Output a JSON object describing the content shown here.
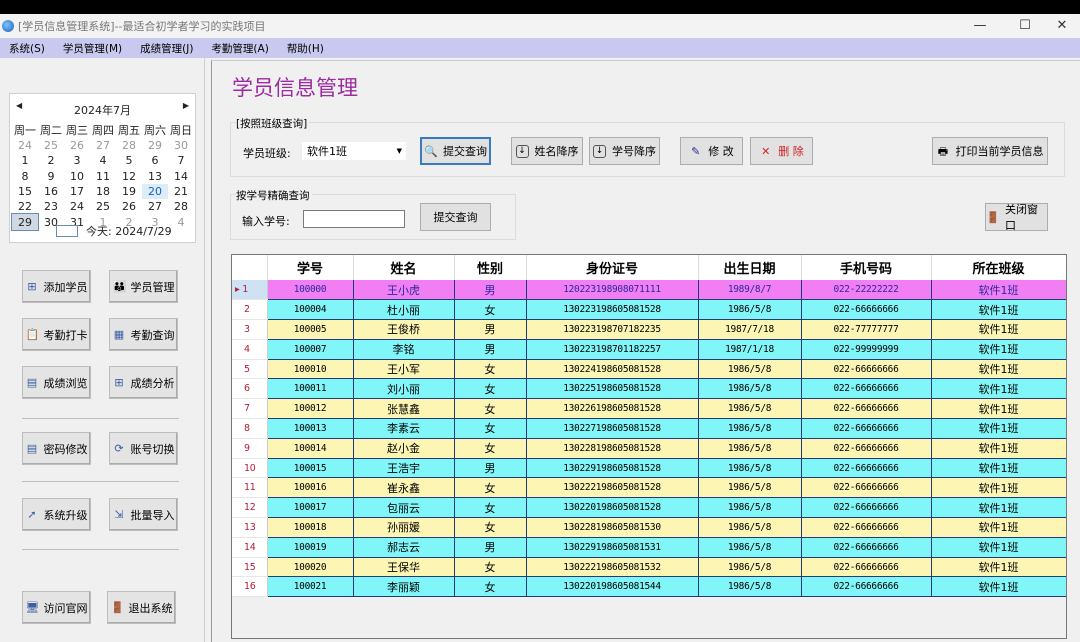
{
  "window": {
    "title": "[学员信息管理系统]--最适合初学者学习的实践项目",
    "minimize": "—",
    "maximize": "☐",
    "close": "✕"
  },
  "menu": [
    "系统(S)",
    "学员管理(M)",
    "成绩管理(J)",
    "考勤管理(A)",
    "帮助(H)"
  ],
  "calendar": {
    "month_label": "2024年7月",
    "weekdays": [
      "周一",
      "周二",
      "周三",
      "周四",
      "周五",
      "周六",
      "周日"
    ],
    "weeks": [
      [
        "24",
        "25",
        "26",
        "27",
        "28",
        "29",
        "30"
      ],
      [
        "1",
        "2",
        "3",
        "4",
        "5",
        "6",
        "7"
      ],
      [
        "8",
        "9",
        "10",
        "11",
        "12",
        "13",
        "14"
      ],
      [
        "15",
        "16",
        "17",
        "18",
        "19",
        "20",
        "21"
      ],
      [
        "22",
        "23",
        "24",
        "25",
        "26",
        "27",
        "28"
      ],
      [
        "29",
        "30",
        "31",
        "1",
        "2",
        "3",
        "4"
      ]
    ],
    "today_label": "今天: 2024/7/29"
  },
  "sidebar": {
    "buttons": [
      {
        "label": "添加学员",
        "icon": "plus-icon"
      },
      {
        "label": "学员管理",
        "icon": "people-icon"
      },
      {
        "label": "考勤打卡",
        "icon": "clipboard-icon"
      },
      {
        "label": "考勤查询",
        "icon": "grid-icon"
      },
      {
        "label": "成绩浏览",
        "icon": "window-icon"
      },
      {
        "label": "成绩分析",
        "icon": "plus-icon"
      },
      {
        "label": "密码修改",
        "icon": "document-icon"
      },
      {
        "label": "账号切换",
        "icon": "switch-icon"
      },
      {
        "label": "系统升级",
        "icon": "upgrade-arrow-icon"
      },
      {
        "label": "批量导入",
        "icon": "import-icon"
      },
      {
        "label": "访问官网",
        "icon": "monitor-icon"
      },
      {
        "label": "退出系统",
        "icon": "exit-door-icon"
      }
    ]
  },
  "main": {
    "title": "学员信息管理",
    "class_query": {
      "group_label": "[按照班级查询]",
      "class_label": "学员班级:",
      "class_value": "软件1班",
      "submit": "提交查询",
      "sort_name": "姓名降序",
      "sort_id": "学号降序",
      "edit": "修 改",
      "delete": "删 除",
      "print": "打印当前学员信息"
    },
    "id_query": {
      "group_label": "按学号精确查询",
      "input_label": "输入学号:",
      "input_value": "",
      "submit": "提交查询"
    },
    "close_window": "关闭窗口"
  },
  "table": {
    "columns": [
      "学号",
      "姓名",
      "性别",
      "身份证号",
      "出生日期",
      "手机号码",
      "所在班级"
    ],
    "rows": [
      [
        "100000",
        "王小虎",
        "男",
        "120223198908071111",
        "1989/8/7",
        "022-22222222",
        "软件1班"
      ],
      [
        "100004",
        "杜小丽",
        "女",
        "130223198605081528",
        "1986/5/8",
        "022-66666666",
        "软件1班"
      ],
      [
        "100005",
        "王俊桥",
        "男",
        "130223198707182235",
        "1987/7/18",
        "022-77777777",
        "软件1班"
      ],
      [
        "100007",
        "李铭",
        "男",
        "130223198701182257",
        "1987/1/18",
        "022-99999999",
        "软件1班"
      ],
      [
        "100010",
        "王小军",
        "女",
        "130224198605081528",
        "1986/5/8",
        "022-66666666",
        "软件1班"
      ],
      [
        "100011",
        "刘小丽",
        "女",
        "130225198605081528",
        "1986/5/8",
        "022-66666666",
        "软件1班"
      ],
      [
        "100012",
        "张慧鑫",
        "女",
        "130226198605081528",
        "1986/5/8",
        "022-66666666",
        "软件1班"
      ],
      [
        "100013",
        "李素云",
        "女",
        "130227198605081528",
        "1986/5/8",
        "022-66666666",
        "软件1班"
      ],
      [
        "100014",
        "赵小金",
        "女",
        "130228198605081528",
        "1986/5/8",
        "022-66666666",
        "软件1班"
      ],
      [
        "100015",
        "王浩宇",
        "男",
        "130229198605081528",
        "1986/5/8",
        "022-66666666",
        "软件1班"
      ],
      [
        "100016",
        "崔永鑫",
        "女",
        "130222198605081528",
        "1986/5/8",
        "022-66666666",
        "软件1班"
      ],
      [
        "100017",
        "包丽云",
        "女",
        "130220198605081528",
        "1986/5/8",
        "022-66666666",
        "软件1班"
      ],
      [
        "100018",
        "孙丽媛",
        "女",
        "130228198605081530",
        "1986/5/8",
        "022-66666666",
        "软件1班"
      ],
      [
        "100019",
        "郝志云",
        "男",
        "130229198605081531",
        "1986/5/8",
        "022-66666666",
        "软件1班"
      ],
      [
        "100020",
        "王保华",
        "女",
        "130222198605081532",
        "1986/5/8",
        "022-66666666",
        "软件1班"
      ],
      [
        "100021",
        "李丽颖",
        "女",
        "130220198605081544",
        "1986/5/8",
        "022-66666666",
        "软件1班"
      ]
    ],
    "selected_row": 1
  },
  "colors": {
    "selected": "#f27ef4",
    "cyan": "#80f6f9",
    "yellow": "#fdf5b4",
    "title": "#9c2aa0",
    "menubar": "#c9c9ef"
  }
}
